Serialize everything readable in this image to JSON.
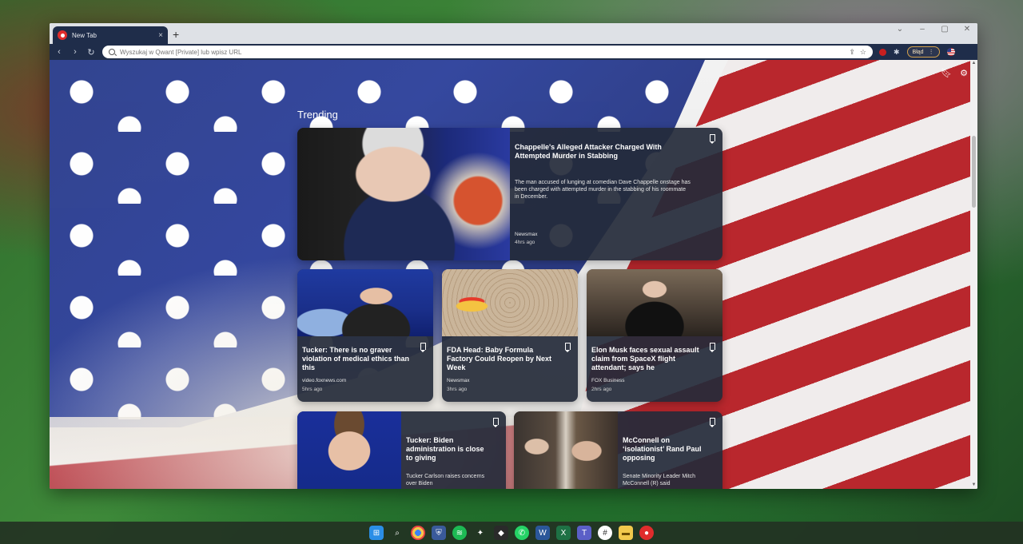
{
  "tab": {
    "title": "New Tab",
    "close": "×"
  },
  "newtab": "+",
  "window_controls": [
    "⌄",
    "–",
    "▢",
    "✕"
  ],
  "nav": {
    "back": "‹",
    "forward": "›",
    "reload": "↻"
  },
  "omnibox": {
    "placeholder": "Wyszukaj w Qwant [Private] lub wpisz URL"
  },
  "toolbar": {
    "error_label": "Błąd",
    "error_more": "⋮"
  },
  "section": {
    "trending": "Trending"
  },
  "cards": [
    {
      "title": "Chappelle's Alleged Attacker Charged With Attempted Murder in Stabbing",
      "desc": "The man accused of lunging at comedian Dave Chappelle onstage has been charged with attempted murder in the stabbing of his roommate in December.",
      "source": "Newsmax",
      "time": "4hrs ago"
    },
    {
      "title": "Tucker: There is no graver violation of medical ethics than this",
      "source": "video.foxnews.com",
      "time": "5hrs ago"
    },
    {
      "title": "FDA Head: Baby Formula Factory Could Reopen by Next Week",
      "source": "Newsmax",
      "time": "3hrs ago"
    },
    {
      "title": "Elon Musk faces sexual assault claim from SpaceX flight attendant; says he",
      "source": "FOX Business",
      "time": "2hrs ago"
    },
    {
      "title": "Tucker: Biden administration is close to giving",
      "desc": "Tucker Carlson raises concerns over Biden"
    },
    {
      "title": "McConnell on ‘isolationist’ Rand Paul opposing",
      "desc": "Senate Minority Leader Mitch McConnell (R) said"
    }
  ],
  "colors": {
    "toolbar": "#1f2d4a",
    "card_bg": "#242a3a",
    "accent_error": "#d4a24c"
  }
}
